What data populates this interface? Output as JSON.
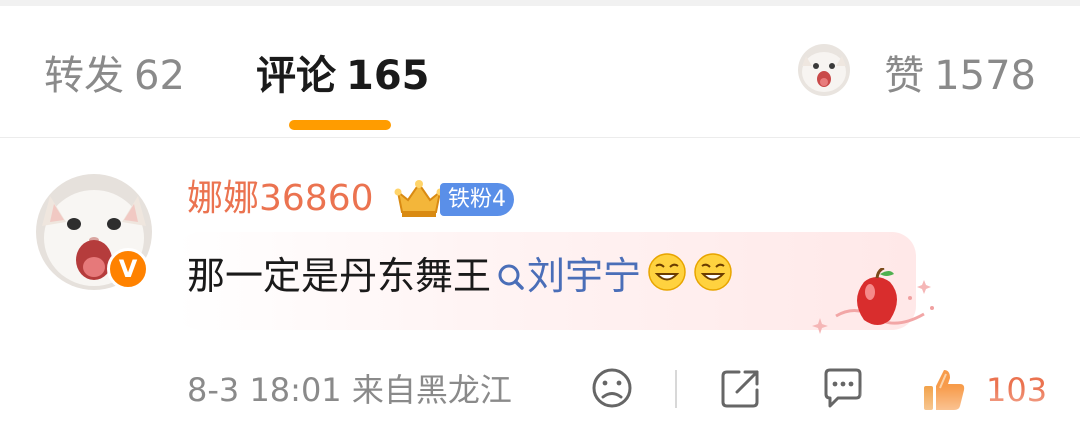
{
  "tabs": {
    "repost": {
      "label": "转发",
      "count": "62"
    },
    "comment": {
      "label": "评论",
      "count": "165"
    },
    "likes": {
      "label": "赞",
      "count": "1578"
    }
  },
  "comment": {
    "username": "娜娜36860",
    "fan_badge": "铁粉4",
    "verified_badge": "V",
    "text": "那一定是丹东舞王",
    "search_link": "刘宇宁",
    "emojis": [
      "grin-emoji",
      "grin-emoji"
    ],
    "meta": "8-3 18:01 来自黑龙江",
    "like_count": "103"
  },
  "colors": {
    "accent": "#ff9c00",
    "username": "#eb7350",
    "link": "#4a6eb8",
    "fan_badge": "#5a8fe8",
    "like": "#eb7350"
  },
  "icons": [
    "sad-face-icon",
    "share-icon",
    "reply-icon",
    "thumbs-up-icon",
    "search-icon",
    "crown-icon",
    "apple-decoration-icon"
  ]
}
